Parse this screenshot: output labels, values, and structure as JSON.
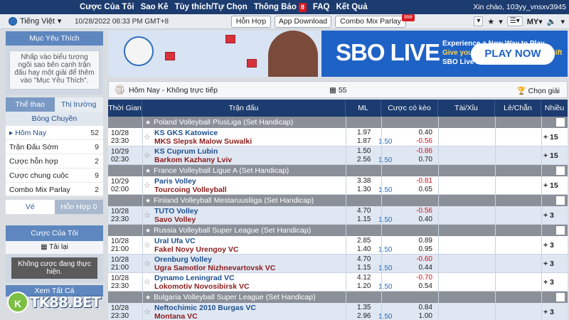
{
  "topnav": {
    "menu": [
      "Cược Của Tôi",
      "Sao Kê",
      "Tùy thích/Tự Chọn",
      "Thông Báo",
      "FAQ",
      "Kết Quả"
    ],
    "notif_count": "8",
    "greeting": "Xin chào, 103yy_vnsxv3945"
  },
  "bar2": {
    "language": "Tiếng Việt",
    "datetime": "10/28/2022 08:33 PM GMT+8",
    "btn_hon_hop": "Hỗn Hợp",
    "btn_download": "App Download",
    "btn_combo": "Combo Mix Parlay",
    "new_badge": "Mới",
    "my_label": "MY"
  },
  "sidebar": {
    "fav_title": "Mục Yêu Thích",
    "fav_hint": "Nhấp vào biểu tượng ngôi sao bên cạnh trận đấu hay một giải để thêm vào \"Mục Yêu Thích\".",
    "tab_sports": "Thể thao",
    "tab_markets": "Thị trường",
    "sport_name": "Bóng Chuyền",
    "items": [
      {
        "label": "Hôm Nay",
        "count": "52"
      },
      {
        "label": "Trận Đấu Sớm",
        "count": "9"
      },
      {
        "label": "Cược hỗn hợp",
        "count": "2"
      },
      {
        "label": "Cược chung cuộc",
        "count": "9"
      },
      {
        "label": "Combo Mix Parlay",
        "count": "2"
      }
    ],
    "tab_ve": "Vé",
    "tab_hon_hop": "Hỗn Hợp",
    "hon_hop_count": "0",
    "my_bets_title": "Cược Của Tôi",
    "reload": "Tải lại",
    "no_bets": "Không cược đang thực hiện.",
    "see_all": "Xem Tất Cả",
    "logo_text": "TK88.BET"
  },
  "banner": {
    "title": "SBO LIVE",
    "line1": "Experience a New Way to Play",
    "line2": "Give your Favourite Streamer a Gift",
    "line3": "SBO Live 2.0 now Online",
    "cta": "PLAY NOW"
  },
  "toolbar": {
    "label": "Hôm Nay - Không trực tiếp",
    "count": "55",
    "pick": "Chọn giải"
  },
  "columns": [
    "Thời Gian",
    "Trận đấu",
    "ML",
    "Cược có kèo",
    "Tài/Xỉu",
    "Lẻ/Chẵn",
    "Nhiều"
  ],
  "leagues": [
    {
      "name": "Poland Volleyball PlusLiga (Set Handicap)",
      "matches": [
        {
          "date": "10/28",
          "time": "23:30",
          "home": "KS GKS Katowice",
          "away": "MKS Slepsk Malow Suwalki",
          "ml1": "1.97",
          "ml2": "1.87",
          "hcp": "1.50",
          "o1": "0.40",
          "o2": "-0.56",
          "more": "+ 15"
        },
        {
          "date": "10/29",
          "time": "02:30",
          "home": "KS Cuprum Lubin",
          "away": "Barkom Kazhany Lviv",
          "ml1": "1.50",
          "ml2": "2.56",
          "hcp": "1.50",
          "o1": "-0.86",
          "o2": "0.70",
          "more": "+ 15"
        }
      ]
    },
    {
      "name": "France Volleyball Ligue A (Set Handicap)",
      "matches": [
        {
          "date": "10/29",
          "time": "02:00",
          "home": "Paris Volley",
          "away": "Tourcoing Volleyball",
          "ml1": "3.38",
          "ml2": "1.30",
          "hcp": "1.50",
          "o1": "-0.81",
          "o2": "0.65",
          "more": "+ 15"
        }
      ]
    },
    {
      "name": "Finland Volleyball Mestaruusliiga (Set Handicap)",
      "matches": [
        {
          "date": "10/28",
          "time": "23:30",
          "home": "TUTO Volley",
          "away": "Savo Volley",
          "ml1": "4.70",
          "ml2": "1.15",
          "hcp": "1.50",
          "o1": "-0.56",
          "o2": "0.40",
          "more": "+ 3"
        }
      ]
    },
    {
      "name": "Russia Volleyball Super League (Set Handicap)",
      "matches": [
        {
          "date": "10/28",
          "time": "21:00",
          "home": "Ural Ufa VC",
          "away": "Fakel Novy Urengoy VC",
          "ml1": "2.85",
          "ml2": "1.40",
          "hcp": "1.50",
          "o1": "0.89",
          "o2": "0.95",
          "more": "+ 3"
        },
        {
          "date": "10/28",
          "time": "21:00",
          "home": "Orenburg Volley",
          "away": "Ugra Samotlor Nizhnevartovsk VC",
          "ml1": "4.70",
          "ml2": "1.15",
          "hcp": "1.50",
          "o1": "-0.60",
          "o2": "0.44",
          "more": "+ 3"
        },
        {
          "date": "10/28",
          "time": "23:30",
          "home": "Dynamo Leningrad VC",
          "away": "Lokomotiv Novosibirsk VC",
          "ml1": "4.12",
          "ml2": "1.20",
          "hcp": "1.50",
          "o1": "-0.70",
          "o2": "0.54",
          "more": "+ 3"
        }
      ]
    },
    {
      "name": "Bulgaria Volleyball Super League (Set Handicap)",
      "matches": [
        {
          "date": "10/28",
          "time": "23:30",
          "home": "Neftochimic 2010 Burgas VC",
          "away": "Montana VC",
          "ml1": "1.35",
          "ml2": "2.96",
          "hcp": "1.50",
          "o1": "0.84",
          "o2": "1.00",
          "more": "+ 3"
        }
      ]
    }
  ]
}
